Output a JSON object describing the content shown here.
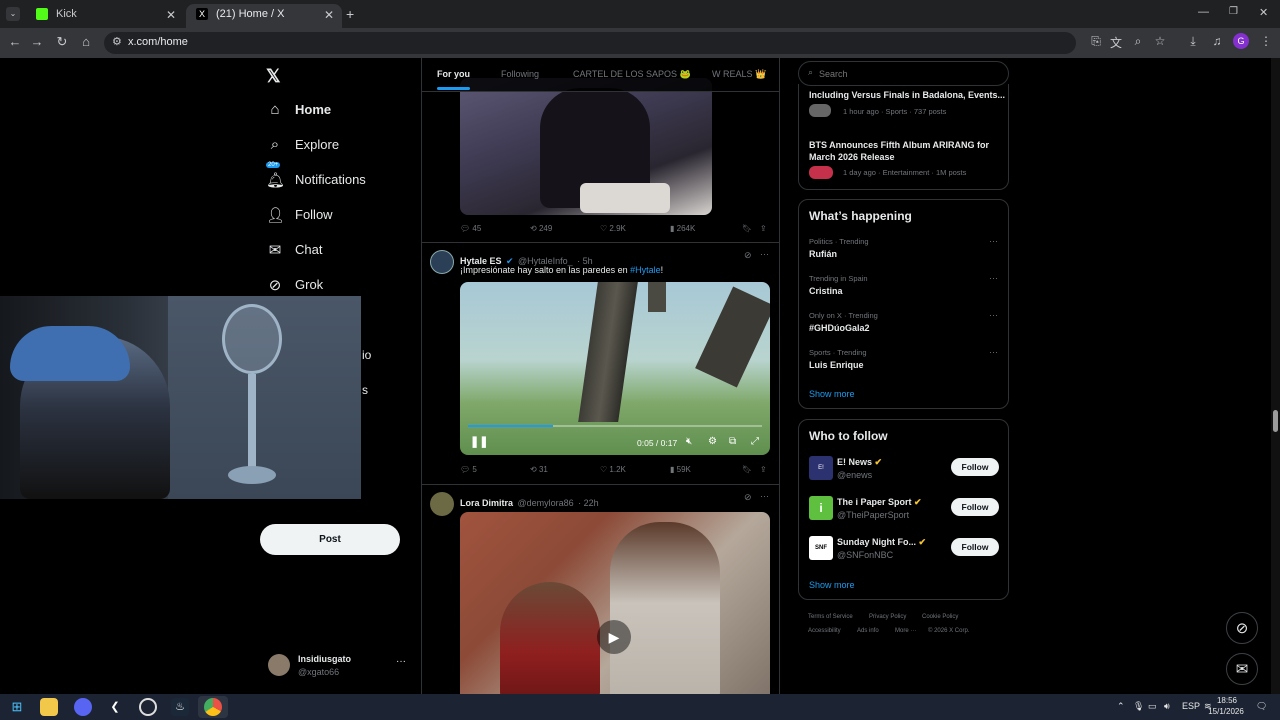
{
  "browser": {
    "tabs": [
      {
        "title": "Kick",
        "active": false
      },
      {
        "title": "(21) Home / X",
        "active": true
      }
    ],
    "url": "x.com/home",
    "profile_initial": "G"
  },
  "sidebar": {
    "items": [
      {
        "label": "Home",
        "icon": "home-icon"
      },
      {
        "label": "Explore",
        "icon": "search-icon"
      },
      {
        "label": "Notifications",
        "icon": "bell-icon",
        "badge": "20+"
      },
      {
        "label": "Follow",
        "icon": "person-add-icon"
      },
      {
        "label": "Chat",
        "icon": "mail-icon"
      },
      {
        "label": "Grok",
        "icon": "grok-icon"
      }
    ],
    "partial_labels": [
      "io",
      "s"
    ],
    "post_label": "Post",
    "account": {
      "name": "Insidiusgato",
      "handle": "@xgato66"
    }
  },
  "feed": {
    "tabs": [
      "For you",
      "Following",
      "CARTEL DE LOS SAPOS 🐸",
      "W REALS 👑"
    ],
    "active_tab": 0,
    "tweets": [
      {
        "name": "",
        "handle": "",
        "time": "",
        "text": "",
        "stats": {
          "replies": "45",
          "reposts": "249",
          "likes": "2.9K",
          "views": "264K"
        }
      },
      {
        "name": "Hytale ES",
        "verified": true,
        "handle": "@HytaleInfo_",
        "time": "· 5h",
        "text": "¡Impresiónate hay salto en las paredes en ",
        "hashtag": "#Hytale",
        "text_end": "!",
        "video_time": "0:05 / 0:17",
        "stats": {
          "replies": "5",
          "reposts": "31",
          "likes": "1.2K",
          "views": "59K"
        }
      },
      {
        "name": "Lora Dimitra",
        "handle": "@demylora86",
        "time": "· 22h",
        "text": ""
      }
    ]
  },
  "right": {
    "search_placeholder": "Search",
    "news": [
      {
        "title": "Including Versus Finals in Badalona, Events...",
        "meta": "1 hour ago · Sports · 737 posts"
      },
      {
        "title": "BTS Announces Fifth Album ARIRANG for",
        "title2": "March 2026 Release",
        "meta": "1 day ago · Entertainment · 1M posts"
      }
    ],
    "whats_happening": {
      "title": "What’s happening",
      "trends": [
        {
          "context": "Politics · Trending",
          "name": "Rufián"
        },
        {
          "context": "Trending in Spain",
          "name": "Cristina"
        },
        {
          "context": "Only on X · Trending",
          "name": "#GHDúoGala2"
        },
        {
          "context": "Sports · Trending",
          "name": "Luis Enrique"
        }
      ],
      "show_more": "Show more"
    },
    "who_to_follow": {
      "title": "Who to follow",
      "accounts": [
        {
          "name": "E! News",
          "handle": "@enews",
          "follow": "Follow",
          "color": "#3a3f8f"
        },
        {
          "name": "The i Paper Sport",
          "handle": "@TheiPaperSport",
          "follow": "Follow",
          "color": "#5fbf3f"
        },
        {
          "name": "Sunday Night Fo...",
          "handle": "@SNFonNBC",
          "follow": "Follow",
          "color": "#ffffff"
        }
      ],
      "show_more": "Show more"
    },
    "footer": [
      "Terms of Service",
      "Privacy Policy",
      "Cookie Policy",
      "Accessibility",
      "Ads info",
      "More ···",
      "© 2026 X Corp."
    ]
  },
  "taskbar": {
    "lang": "ESP",
    "time": "18:56",
    "date": "15/1/2026"
  },
  "colors": {
    "accent": "#1d9bf0",
    "verified": "#f4c430"
  }
}
